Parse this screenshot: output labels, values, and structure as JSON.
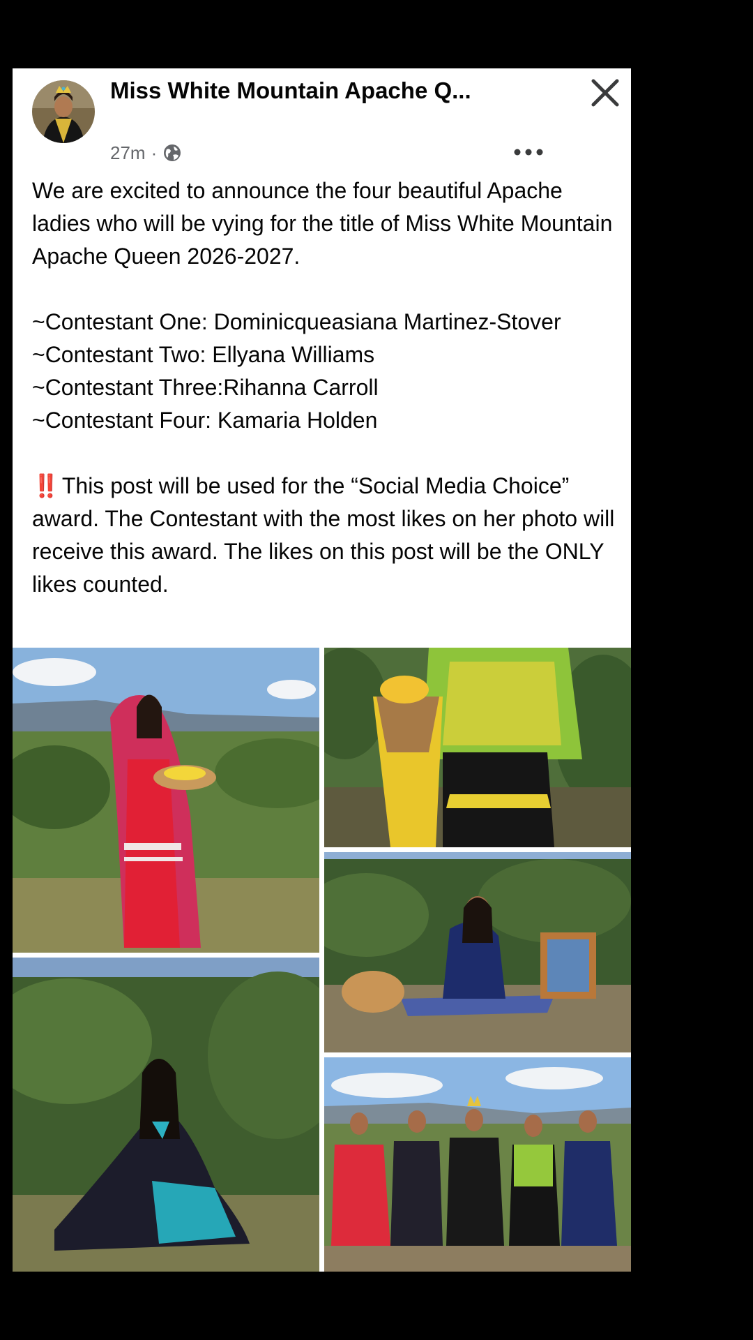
{
  "post": {
    "page_name": "Miss White Mountain Apache Q...",
    "timestamp": "27m",
    "separator": "·",
    "audience_icon": "globe-icon",
    "more_icon": "more-options-icon",
    "close_icon": "close-icon",
    "body": {
      "intro": "We are excited to announce the four beautiful Apache ladies who will be vying for the title of Miss White Mountain Apache Queen 2026-2027.",
      "contestants": [
        "~Contestant One: Dominicqueasiana Martinez-Stover",
        "~Contestant Two: Ellyana Williams",
        "~Contestant Three:Rihanna Carroll",
        "~Contestant Four: Kamaria Holden"
      ],
      "notice_emoji": "‼️",
      "notice": "This post will be used for the “Social Media Choice” award. The Contestant with the most likes on her photo will receive this award. The likes on this post will be the ONLY likes counted."
    }
  },
  "photos": [
    {
      "subject": "contestant in red camp dress with pink shawl holding flower basket"
    },
    {
      "subject": "contestant in yellow and green camp dress holding burden basket"
    },
    {
      "subject": "contestant in navy blue camp dress seated beside basket and framed painting"
    },
    {
      "subject": "contestant in black floral camp dress seated in grass"
    },
    {
      "subject": "group of five women in camp dresses with sashes"
    }
  ],
  "colors": {
    "background": "#000000",
    "card": "#ffffff",
    "text": "#050505",
    "meta": "#65676b",
    "notice_emoji": "#e41e3f"
  }
}
